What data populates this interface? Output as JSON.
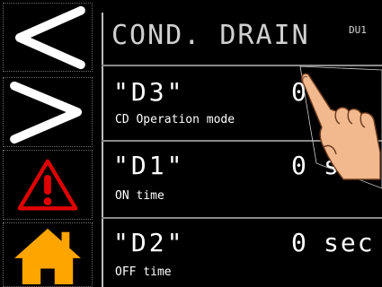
{
  "header": {
    "title": "COND. DRAIN",
    "device_id": "DU1"
  },
  "nav": [
    {
      "name": "back-button",
      "icon": "chevron-left-icon"
    },
    {
      "name": "next-button",
      "icon": "chevron-right-icon"
    },
    {
      "name": "alarm-button",
      "icon": "warning-icon"
    },
    {
      "name": "home-button",
      "icon": "home-icon"
    }
  ],
  "params": [
    {
      "code": "\"D3\"",
      "label": "CD Operation mode",
      "value": "0",
      "unit": ""
    },
    {
      "code": "\"D1\"",
      "label": "ON time",
      "value": "0",
      "unit": "sec"
    },
    {
      "code": "\"D2\"",
      "label": "OFF time",
      "value": "0",
      "unit": "sec"
    }
  ],
  "colors": {
    "background": "#000000",
    "alarm": "#e00000",
    "home": "#ffa500",
    "text": "#ffffff"
  }
}
